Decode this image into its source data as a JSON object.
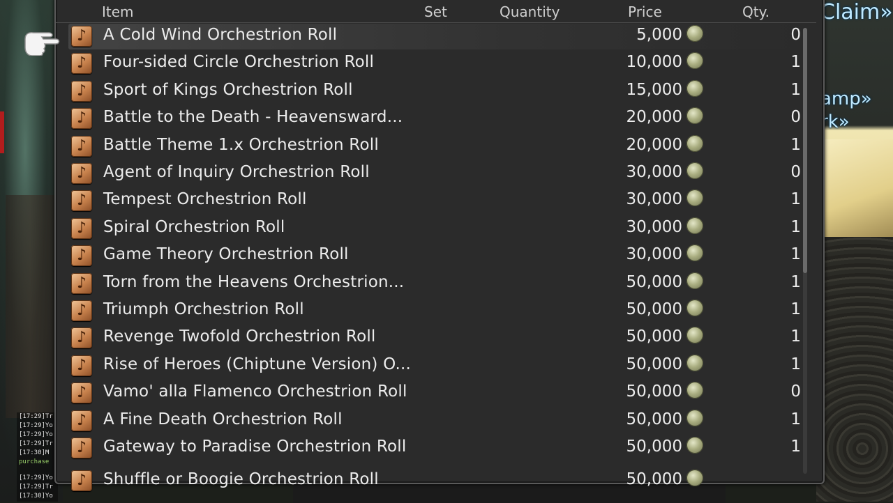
{
  "world": {
    "nameplates": [
      "Claim»",
      "amp»",
      "rk»"
    ]
  },
  "chat": {
    "lines": [
      "[17:29]Tr",
      "[17:29]Yo",
      "[17:29]Yo",
      "[17:29]Tr",
      "[17:30]M",
      "purchase",
      "[17:29]Yo",
      "[17:29]Tr",
      "[17:30]Yo"
    ]
  },
  "shop": {
    "columns": {
      "item": "Item",
      "set": "Set",
      "quantity": "Quantity",
      "price": "Price",
      "qty": "Qty."
    },
    "rows": [
      {
        "name": "A Cold Wind Orchestrion Roll",
        "price": "5,000",
        "owned": "0"
      },
      {
        "name": "Four-sided Circle Orchestrion Roll",
        "price": "10,000",
        "owned": "1"
      },
      {
        "name": "Sport of Kings Orchestrion Roll",
        "price": "15,000",
        "owned": "1"
      },
      {
        "name": "Battle to the Death - Heavensward...",
        "price": "20,000",
        "owned": "0"
      },
      {
        "name": "Battle Theme 1.x Orchestrion Roll",
        "price": "20,000",
        "owned": "1"
      },
      {
        "name": "Agent of Inquiry Orchestrion Roll",
        "price": "30,000",
        "owned": "0"
      },
      {
        "name": "Tempest Orchestrion Roll",
        "price": "30,000",
        "owned": "1"
      },
      {
        "name": "Spiral Orchestrion Roll",
        "price": "30,000",
        "owned": "1"
      },
      {
        "name": "Game Theory Orchestrion Roll",
        "price": "30,000",
        "owned": "1"
      },
      {
        "name": "Torn from the Heavens Orchestrion...",
        "price": "50,000",
        "owned": "1"
      },
      {
        "name": "Triumph Orchestrion Roll",
        "price": "50,000",
        "owned": "1"
      },
      {
        "name": "Revenge Twofold Orchestrion Roll",
        "price": "50,000",
        "owned": "1"
      },
      {
        "name": "Rise of Heroes (Chiptune Version) O...",
        "price": "50,000",
        "owned": "1"
      },
      {
        "name": "Vamo' alla Flamenco Orchestrion Roll",
        "price": "50,000",
        "owned": "0"
      },
      {
        "name": "A Fine Death Orchestrion Roll",
        "price": "50,000",
        "owned": "1"
      },
      {
        "name": "Gateway to Paradise Orchestrion Roll",
        "price": "50,000",
        "owned": "1"
      },
      {
        "name": "Shuffle or Boogie Orchestrion Roll",
        "price": "50,000",
        "owned": ""
      }
    ],
    "selected_index": 0,
    "scroll_fraction": 0.55,
    "icon": "orchestrion-roll-icon",
    "currency_icon": "gil-coin-icon"
  }
}
